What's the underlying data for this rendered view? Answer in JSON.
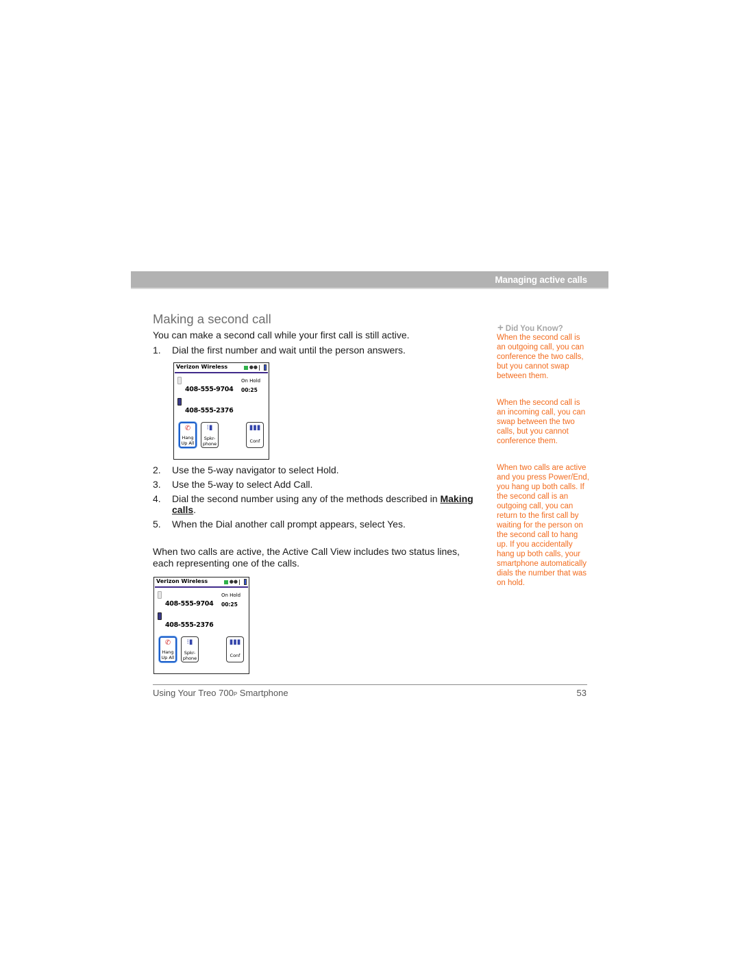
{
  "section_header": "Managing active calls",
  "heading": "Making a second call",
  "intro": "You can make a second call while your first call is still active.",
  "steps": [
    {
      "num": "1.",
      "text": "Dial the first number and wait until the person answers."
    },
    {
      "num": "2.",
      "text": "Use the 5-way navigator to select Hold."
    },
    {
      "num": "3.",
      "text": "Use the 5-way to select Add Call."
    },
    {
      "num": "4.",
      "text": "Dial the second number using any of the methods described in",
      "link": "Making calls",
      "after": "."
    },
    {
      "num": "5.",
      "text": "When the Dial another call prompt appears, select Yes."
    }
  ],
  "paragraph": "When two calls are active, the Active Call View includes two status lines, each representing one of the calls.",
  "phone_screen": {
    "carrier": "Verizon Wireless",
    "status_icons": [
      "battery-green-icon",
      "data-dots-icon",
      "antenna-icon",
      "phone-status-icon"
    ],
    "call1": {
      "number": "408-555-9704",
      "status": "On Hold",
      "timer": "00:25",
      "icon": "held-call-icon"
    },
    "call2": {
      "number": "408-555-2376",
      "icon": "active-call-icon"
    },
    "buttons": [
      {
        "label1": "Hang",
        "label2": "Up All",
        "icon": "handset-icon",
        "focused": true
      },
      {
        "label1": "Spkr-",
        "label2": "phone",
        "icon": "speakerphone-icon",
        "focused": false
      },
      {
        "label1": "Conf",
        "label2": "",
        "icon": "conference-icon",
        "focused": false
      }
    ]
  },
  "sidebar": {
    "title": "Did You Know?",
    "tips": [
      "When the second call is an outgoing call, you can conference the two calls, but you cannot swap between them.",
      "When the second call is an incoming call, you can swap between the two calls, but you cannot conference them.",
      "When two calls are active and you press Power/End, you hang up both calls. If the second call is an outgoing call, you can return to the first call by waiting for the person on the second call to hang up. If you accidentally hang up both calls, your smartphone automatically dials the number that was on hold."
    ],
    "accent_color": "#f26b1d"
  },
  "footer": {
    "title_pre": "Using Your Treo 700",
    "title_sc": "P",
    "title_post": " Smartphone",
    "page": "53"
  }
}
